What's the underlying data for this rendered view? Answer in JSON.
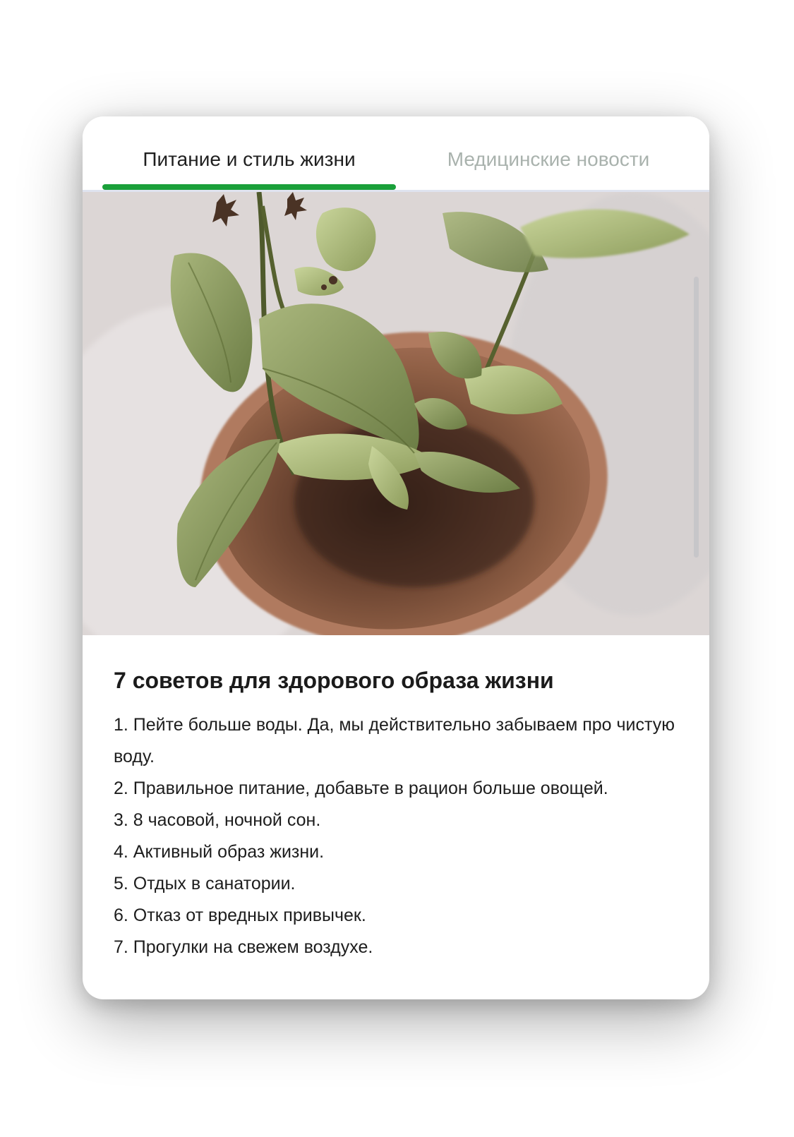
{
  "tabs": [
    {
      "label": "Питание и стиль жизни",
      "active": true
    },
    {
      "label": "Медицинские новости",
      "active": false
    }
  ],
  "colors": {
    "accent": "#1aa03a",
    "tab_inactive": "#a9b2ad",
    "text": "#1d1d1d"
  },
  "article": {
    "title": "7 советов для здорового образа жизни",
    "tips": [
      "1. Пейте больше воды. Да, мы действительно забываем про чистую воду.",
      "2. Правильное питание, добавьте в рацион больше овощей.",
      "3. 8 часовой, ночной сон.",
      "4. Активный образ жизни.",
      "5. Отдых в санатории.",
      "6. Отказ от вредных привычек.",
      "7. Прогулки на свежем воздухе."
    ]
  }
}
